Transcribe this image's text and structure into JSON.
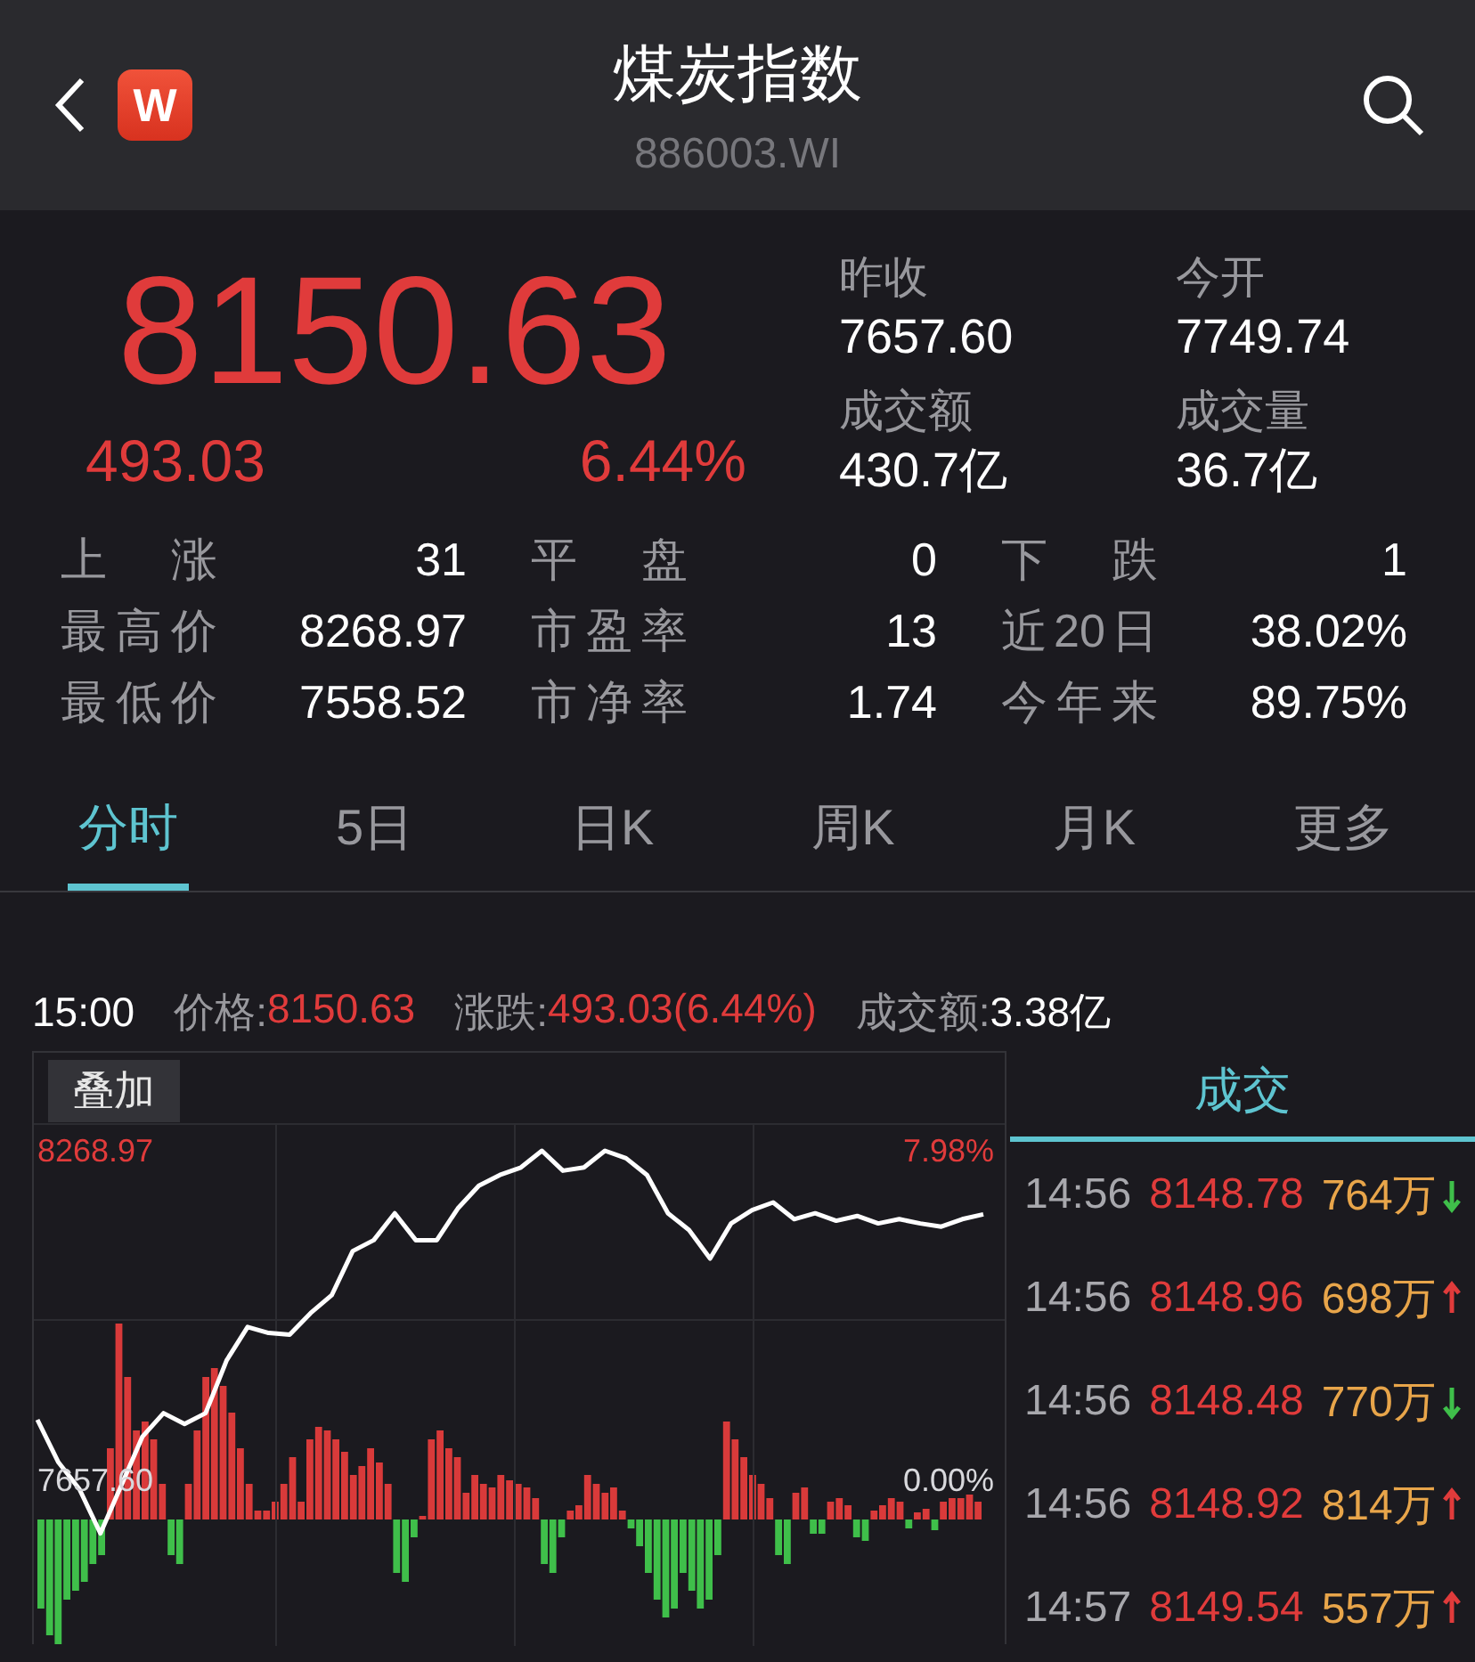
{
  "header": {
    "title": "煤炭指数",
    "code": "886003.WI",
    "logo": "W"
  },
  "quote": {
    "price": "8150.63",
    "change": "493.03",
    "change_pct": "6.44%",
    "summary": [
      {
        "label": "昨收",
        "value": "7657.60"
      },
      {
        "label": "今开",
        "value": "7749.74"
      },
      {
        "label": "成交额",
        "value": "430.7亿"
      },
      {
        "label": "成交量",
        "value": "36.7亿"
      }
    ]
  },
  "stats": [
    {
      "label": "上涨",
      "value": "31"
    },
    {
      "label": "平盘",
      "value": "0"
    },
    {
      "label": "下跌",
      "value": "1"
    },
    {
      "label": "最高价",
      "value": "8268.97"
    },
    {
      "label": "市盈率",
      "value": "13"
    },
    {
      "label": "近20日",
      "value": "38.02%"
    },
    {
      "label": "最低价",
      "value": "7558.52"
    },
    {
      "label": "市净率",
      "value": "1.74"
    },
    {
      "label": "今年来",
      "value": "89.75%"
    }
  ],
  "tabs": [
    {
      "label": "分时",
      "selected": true
    },
    {
      "label": "5日",
      "selected": false
    },
    {
      "label": "日K",
      "selected": false
    },
    {
      "label": "周K",
      "selected": false
    },
    {
      "label": "月K",
      "selected": false
    },
    {
      "label": "更多",
      "selected": false
    }
  ],
  "info": {
    "time": "15:00",
    "items": [
      {
        "label": "价格:",
        "value": "8150.63",
        "kind": "up"
      },
      {
        "label": "涨跌:",
        "value": "493.03(6.44%)",
        "kind": "up"
      },
      {
        "label": "成交额:",
        "value": "3.38亿",
        "kind": "plain"
      }
    ]
  },
  "chart": {
    "overlay_button": "叠加",
    "percent_labels": [
      "7.98%",
      "0.00%"
    ],
    "chart_data": {
      "type": "line",
      "categories": [
        null,
        null,
        null,
        null,
        null,
        null,
        null,
        null,
        null,
        null,
        null,
        null,
        null,
        null,
        null,
        null,
        null,
        null,
        null,
        null,
        null,
        null,
        null,
        null,
        null,
        null,
        null,
        null,
        null,
        null,
        null,
        null,
        null,
        null,
        null,
        null,
        null,
        null,
        null,
        null,
        null,
        null,
        null,
        null,
        null,
        null
      ],
      "ylim": [
        7350.2,
        8450.7
      ],
      "yticks": [
        {
          "value": 8268.97,
          "label": "8268.97"
        },
        {
          "value": 7657.6,
          "label": "7657.60"
        }
      ],
      "series": [
        {
          "color": "#ffffff",
          "values": [
            7770,
            7691,
            7641,
            7559,
            7649,
            7739,
            7782,
            7762,
            7782,
            7880,
            7942,
            7931,
            7928,
            7968,
            8001,
            8083,
            8103,
            8153,
            8103,
            8103,
            8162,
            8204,
            8224,
            8238,
            8269,
            8232,
            8238,
            8269,
            8255,
            8224,
            8153,
            8122,
            8069,
            8134,
            8159,
            8173,
            8142,
            8153,
            8139,
            8148,
            8134,
            8142,
            8134,
            8128,
            8142,
            8151
          ]
        }
      ]
    }
  },
  "trades": {
    "title": "成交",
    "rows": [
      {
        "time": "14:56",
        "price": "8148.78",
        "volume": "764万",
        "kind": "down"
      },
      {
        "time": "14:56",
        "price": "8148.96",
        "volume": "698万",
        "kind": "up"
      },
      {
        "time": "14:56",
        "price": "8148.48",
        "volume": "770万",
        "kind": "down"
      },
      {
        "time": "14:56",
        "price": "8148.92",
        "volume": "814万",
        "kind": "up"
      },
      {
        "time": "14:57",
        "price": "8149.54",
        "volume": "557万",
        "kind": "up"
      }
    ]
  }
}
